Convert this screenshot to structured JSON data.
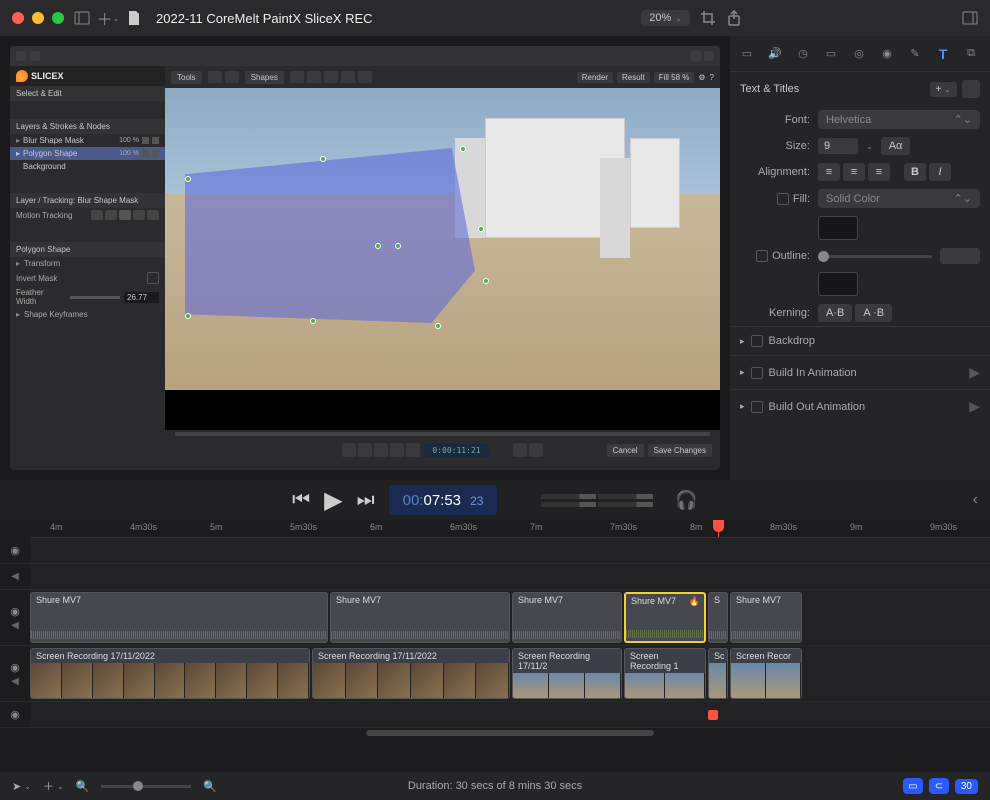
{
  "titlebar": {
    "title": "2022-11 CoreMelt PaintX SliceX REC",
    "zoom": "20%"
  },
  "plugin": {
    "logo": "SLICEX",
    "select_edit": "Select & Edit",
    "tools_tab": "Tools",
    "shapes_tab": "Shapes",
    "render_label": "Render",
    "result_label": "Result",
    "fill_label": "Fill 58 %",
    "layers_header": "Layers & Strokes & Nodes",
    "layers": [
      {
        "name": "Blur Shape Mask",
        "pct": "100 %"
      },
      {
        "name": "Polygon Shape",
        "pct": "100 %"
      },
      {
        "name": "Background",
        "pct": ""
      }
    ],
    "tracking_header": "Layer / Tracking: Blur Shape Mask",
    "motion_tracking": "Motion Tracking",
    "polygon_header": "Polygon Shape",
    "props": {
      "transform": "Transform",
      "invert": "Invert Mask",
      "feather": "Feather Width",
      "feather_val": "26.77",
      "keyframes": "Shape Keyframes"
    },
    "preview_tc": "0:00:11:21",
    "cancel": "Cancel",
    "save": "Save Changes"
  },
  "inspector": {
    "header": "Text & Titles",
    "plus": "+",
    "font_label": "Font:",
    "font_value": "Helvetica",
    "size_label": "Size:",
    "size_value": "9",
    "size_auto": "Aα",
    "alignment_label": "Alignment:",
    "bold": "B",
    "italic": "I",
    "fill_label": "Fill:",
    "fill_type": "Solid Color",
    "outline_label": "Outline:",
    "kerning_label": "Kerning:",
    "kerning_ab1": "A·B",
    "kerning_ab2": "A ·B",
    "accordion": {
      "backdrop": "Backdrop",
      "build_in": "Build In Animation",
      "build_out": "Build Out Animation"
    }
  },
  "transport": {
    "timecode_pre": "00:",
    "timecode_main": "07:53",
    "timecode_frames": "23"
  },
  "timeline": {
    "ruler": [
      "4m",
      "4m30s",
      "5m",
      "5m30s",
      "6m",
      "6m30s",
      "7m",
      "7m30s",
      "8m",
      "8m30s",
      "9m",
      "9m30s"
    ],
    "audio_clip_name": "Shure MV7",
    "audio_s": "S",
    "video_clip_name": "Screen Recording 17/11/2022",
    "video_clip_short": "Screen Recording 17/11/2",
    "video_clip_shorter": "Screen Recording 1",
    "video_clip_shortest": "Screen Recor",
    "video_sc": "Sc"
  },
  "bottombar": {
    "duration": "Duration: 30 secs of 8 mins 30 secs",
    "badge": "30"
  }
}
